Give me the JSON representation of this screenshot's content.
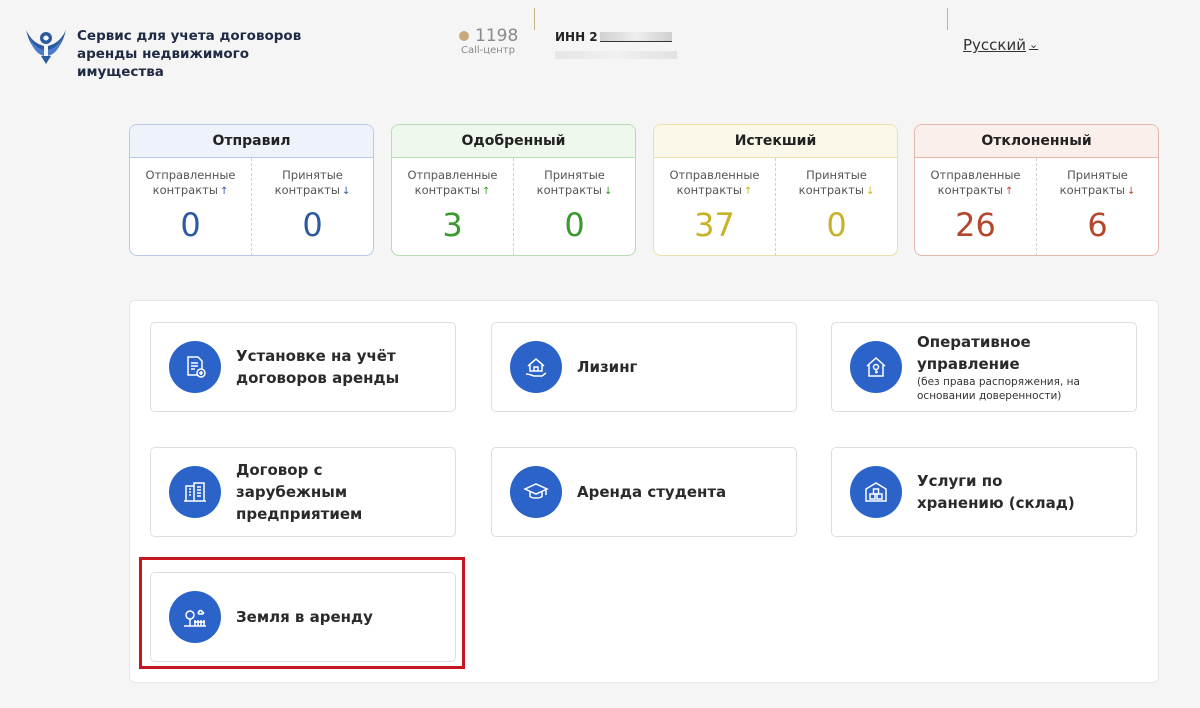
{
  "header": {
    "brand": "Сервис для учета договоров аренды недвижимого имущества",
    "phone": "1198",
    "call_label": "Call-центр",
    "inn_label": "ИНН 2",
    "language": "Русский"
  },
  "stats": [
    {
      "title": "Отправил",
      "left_label": "Отправленные контракты",
      "right_label": "Принятые контракты",
      "left_value": "0",
      "right_value": "0",
      "accent": "#2c5aa0",
      "border": "#b9c9e8",
      "head_bg": "#eef3fb"
    },
    {
      "title": "Одобренный",
      "left_label": "Отправленные контракты",
      "right_label": "Принятые контракты",
      "left_value": "3",
      "right_value": "0",
      "accent": "#3a9a2e",
      "border": "#b6dcb1",
      "head_bg": "#eef8ec"
    },
    {
      "title": "Истекший",
      "left_label": "Отправленные контракты",
      "right_label": "Принятые контракты",
      "left_value": "37",
      "right_value": "0",
      "accent": "#c9b22a",
      "border": "#ebe0a8",
      "head_bg": "#fbf8e9"
    },
    {
      "title": "Отклоненный",
      "left_label": "Отправленные контракты",
      "right_label": "Принятые контракты",
      "left_value": "26",
      "right_value": "6",
      "accent": "#b2492f",
      "border": "#e4b7aa",
      "head_bg": "#fbefeb"
    }
  ],
  "services": [
    {
      "title": "Установке на учёт договоров аренды",
      "subtitle": "",
      "icon": "document-plus-icon"
    },
    {
      "title": "Лизинг",
      "subtitle": "",
      "icon": "house-hand-icon"
    },
    {
      "title": "Оперативное управление",
      "subtitle": "(без права распоряжения, на основании доверенности)",
      "icon": "house-key-icon"
    },
    {
      "title": "Договор с зарубежным предприятием",
      "subtitle": "",
      "icon": "buildings-icon"
    },
    {
      "title": "Аренда студента",
      "subtitle": "",
      "icon": "graduation-cap-icon"
    },
    {
      "title": "Услуги по хранению (склад)",
      "subtitle": "",
      "icon": "warehouse-icon"
    },
    {
      "title": "Земля в аренду",
      "subtitle": "",
      "icon": "land-fence-icon"
    }
  ],
  "colors": {
    "icon_bg": "#2c63c9",
    "highlight": "#c4161c"
  }
}
